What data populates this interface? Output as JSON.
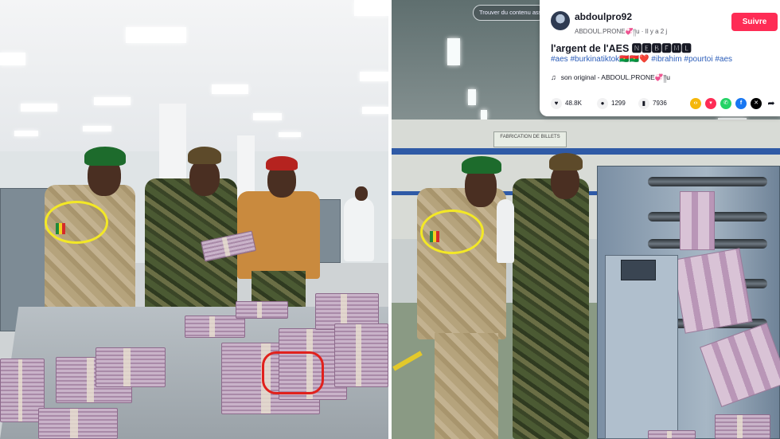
{
  "tiktok": {
    "search_placeholder": "Trouver du contenu ass",
    "username": "abdoulpro92",
    "meta": "ABDOUL.PRONE💞།།u · Il y a 2 j",
    "follow_label": "Suivre",
    "caption": "l'argent de l'AES 🅽🅴🅱🅵🅼🅻",
    "hashtags": "#aes #burkinatiktok🇧🇫🇧🇫❤️ #ibrahim #pourtoi #aes",
    "music": "son original - ABDOUL.PRONE💞།།u",
    "likes": "48.8K",
    "comments": "1299",
    "saves": "7936",
    "icons": {
      "likes": "heart-icon",
      "comments": "comment-icon",
      "saves": "bookmark-icon",
      "share": [
        "embed-icon",
        "tiktok-share-icon",
        "whatsapp-icon",
        "facebook-icon",
        "x-icon",
        "share-arrow-icon"
      ]
    },
    "colors": {
      "follow": "#fe2c55",
      "hashtag": "#2b5db9"
    }
  },
  "scene": {
    "sign_text": "FABRICATION DE BILLETS"
  },
  "annotations": {
    "left_circle_color": "#f3e826",
    "money_circle_color": "#e0211d"
  }
}
